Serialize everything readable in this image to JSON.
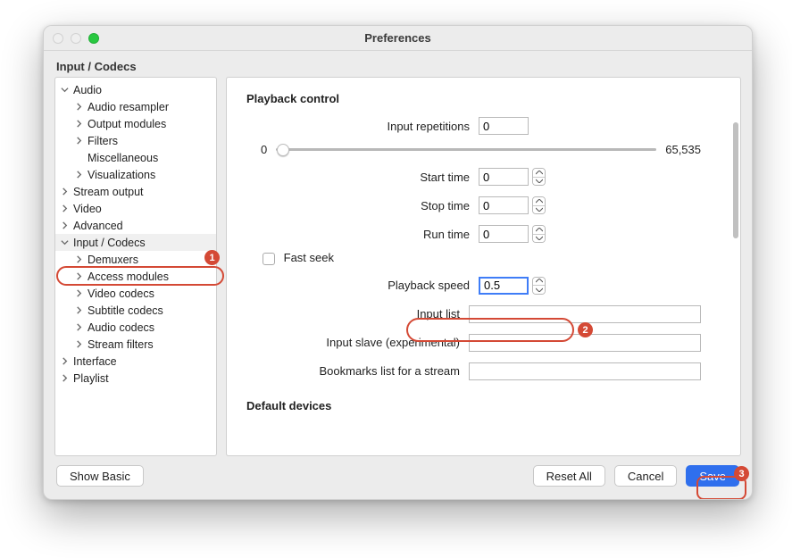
{
  "window_title": "Preferences",
  "sidebar_header": "Input / Codecs",
  "tree": {
    "audio": "Audio",
    "audio_children": [
      "Audio resampler",
      "Output modules",
      "Filters",
      "Miscellaneous",
      "Visualizations"
    ],
    "stream_output": "Stream output",
    "video": "Video",
    "advanced": "Advanced",
    "input_codecs": "Input / Codecs",
    "input_codecs_children": [
      "Demuxers",
      "Access modules",
      "Video codecs",
      "Subtitle codecs",
      "Audio codecs",
      "Stream filters"
    ],
    "interface": "Interface",
    "playlist": "Playlist"
  },
  "playback": {
    "section_title": "Playback control",
    "input_repetitions_label": "Input repetitions",
    "input_repetitions_value": "0",
    "slider_min": "0",
    "slider_max": "65,535",
    "start_time_label": "Start time",
    "start_time_value": "0",
    "stop_time_label": "Stop time",
    "stop_time_value": "0",
    "run_time_label": "Run time",
    "run_time_value": "0",
    "fast_seek_label": "Fast seek",
    "playback_speed_label": "Playback speed",
    "playback_speed_value": "0.5",
    "input_list_label": "Input list",
    "input_list_value": "",
    "input_slave_label": "Input slave (experimental)",
    "input_slave_value": "",
    "bookmarks_label": "Bookmarks list for a stream",
    "bookmarks_value": ""
  },
  "default_devices_title": "Default devices",
  "footer": {
    "show_basic": "Show Basic",
    "reset_all": "Reset All",
    "cancel": "Cancel",
    "save": "Save"
  },
  "annotations": [
    "1",
    "2",
    "3"
  ]
}
